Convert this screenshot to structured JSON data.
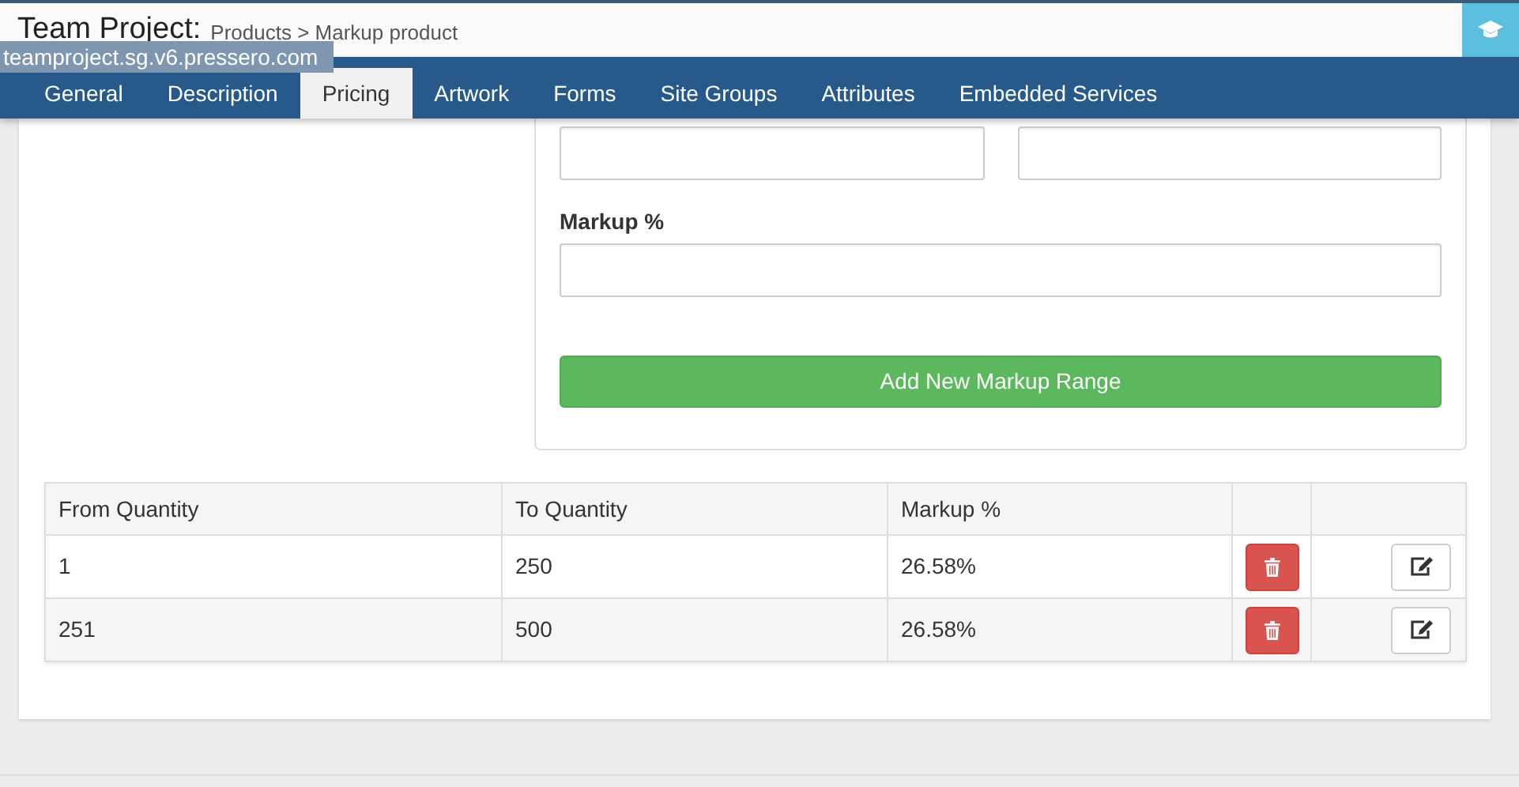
{
  "header": {
    "title": "Team Project:",
    "breadcrumb": [
      "Products",
      "Markup product"
    ],
    "breadcrumb_separator": ">"
  },
  "url_tooltip": "teamproject.sg.v6.pressero.com",
  "tabs": [
    {
      "label": "General",
      "selected": false
    },
    {
      "label": "Description",
      "selected": false
    },
    {
      "label": "Pricing",
      "selected": true
    },
    {
      "label": "Artwork",
      "selected": false
    },
    {
      "label": "Forms",
      "selected": false
    },
    {
      "label": "Site Groups",
      "selected": false
    },
    {
      "label": "Attributes",
      "selected": false
    },
    {
      "label": "Embedded Services",
      "selected": false
    }
  ],
  "form": {
    "markup_label": "Markup %",
    "add_button": "Add New Markup Range"
  },
  "table": {
    "columns": [
      "From Quantity",
      "To Quantity",
      "Markup %"
    ],
    "rows": [
      {
        "from": "1",
        "to": "250",
        "markup": "26.58%"
      },
      {
        "from": "251",
        "to": "500",
        "markup": "26.58%"
      }
    ]
  }
}
